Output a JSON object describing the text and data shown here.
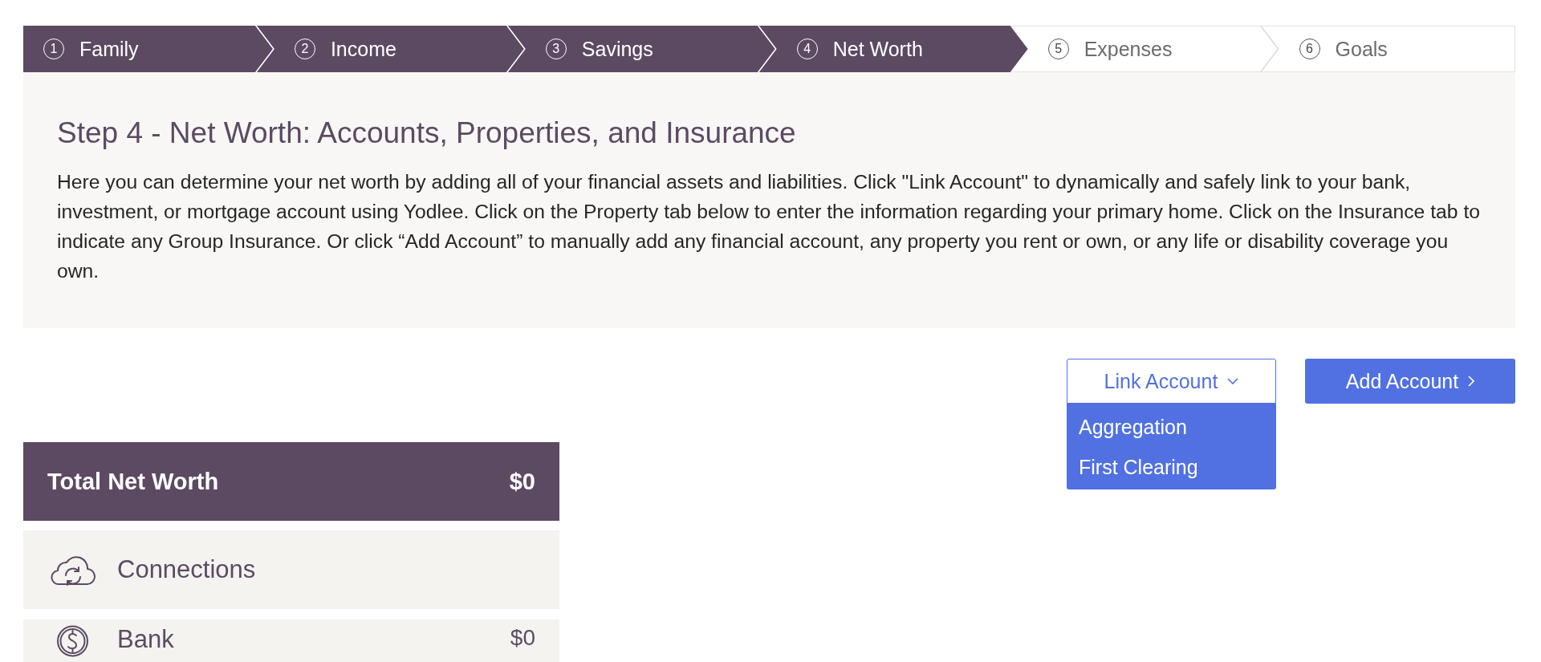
{
  "steps": [
    {
      "number": "1",
      "label": "Family",
      "highlighted": true
    },
    {
      "number": "2",
      "label": "Income",
      "highlighted": true
    },
    {
      "number": "3",
      "label": "Savings",
      "highlighted": true
    },
    {
      "number": "4",
      "label": "Net Worth",
      "highlighted": true
    },
    {
      "number": "5",
      "label": "Expenses",
      "highlighted": false
    },
    {
      "number": "6",
      "label": "Goals",
      "highlighted": false
    }
  ],
  "intro": {
    "title": "Step 4 - Net Worth: Accounts, Properties, and Insurance",
    "text": "Here you can determine your net worth by adding all of your financial assets and liabilities. Click \"Link Account\" to dynamically and safely link to your bank, investment, or mortgage account using Yodlee. Click on the Property tab below to enter the information regarding your primary home. Click on the Insurance tab to indicate any Group Insurance. Or click “Add Account” to manually add any financial account, any property you rent or own, or any life or disability coverage you own."
  },
  "actions": {
    "link_account": {
      "label": "Link Account",
      "expanded": true,
      "menu": [
        "Aggregation",
        "First Clearing"
      ]
    },
    "add_account": {
      "label": "Add Account"
    }
  },
  "summary": {
    "total": {
      "label": "Total Net Worth",
      "value": "$0"
    },
    "categories": [
      {
        "kind": "connections",
        "label": "Connections"
      },
      {
        "kind": "account",
        "label": "Bank",
        "value": "$0"
      }
    ]
  }
}
